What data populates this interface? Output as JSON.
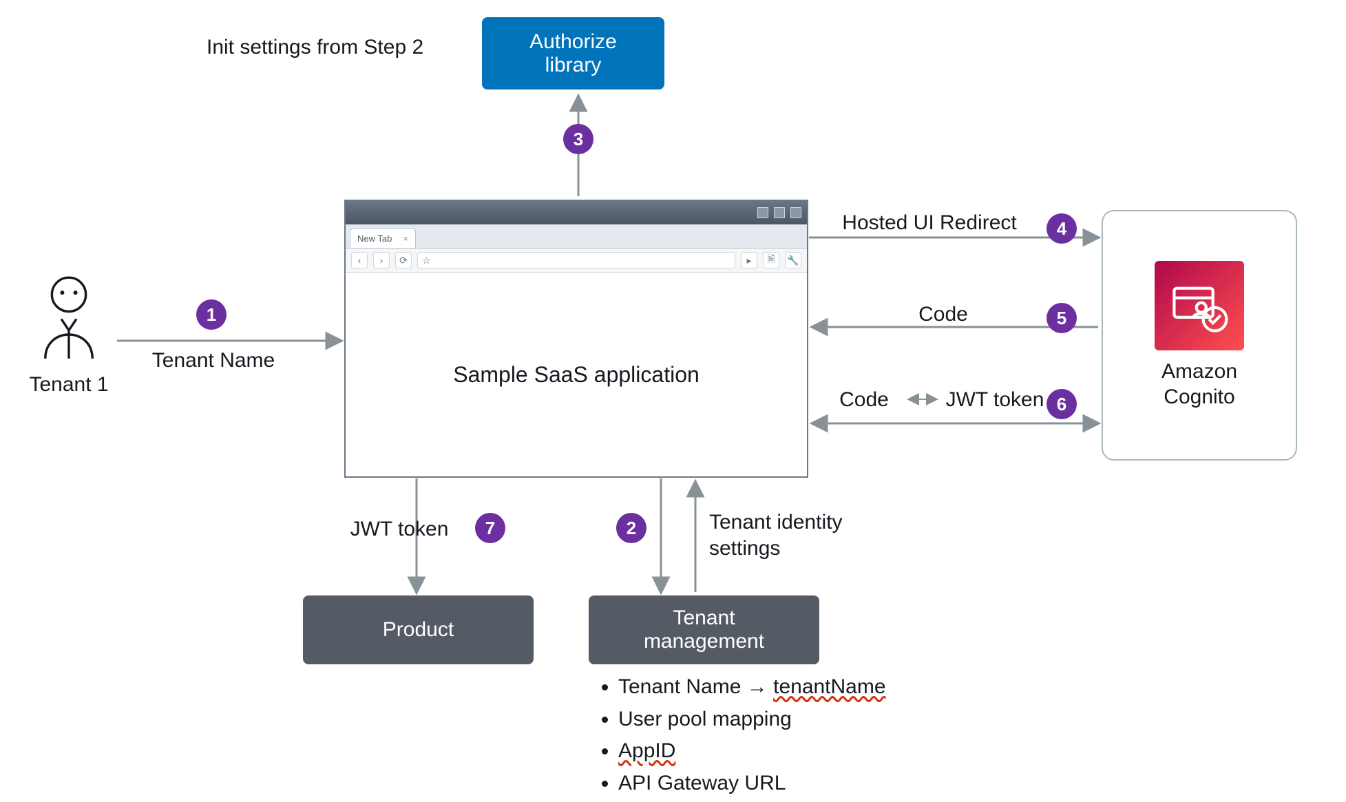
{
  "actors": {
    "tenant_label": "Tenant 1"
  },
  "browser": {
    "tab_label": "New Tab",
    "body_text": "Sample SaaS application"
  },
  "boxes": {
    "authorize": "Authorize\nlibrary",
    "product": "Product",
    "tenant_mgmt": "Tenant\nmanagement",
    "cognito": "Amazon\nCognito"
  },
  "steps": {
    "s1": "1",
    "s2": "2",
    "s3": "3",
    "s4": "4",
    "s5": "5",
    "s6": "6",
    "s7": "7"
  },
  "edge_labels": {
    "tenant_name": "Tenant Name",
    "init_settings": "Init settings from Step 2",
    "hosted_ui": "Hosted UI Redirect",
    "code": "Code",
    "code_jwt_left": "Code",
    "code_jwt_right": "JWT token",
    "jwt_token": "JWT token",
    "tenant_identity": "Tenant identity\nsettings"
  },
  "tenant_mgmt_details": {
    "b1_prefix": "Tenant Name → ",
    "b1_em": "tenantName",
    "b2": "User pool mapping",
    "b3": "AppID",
    "b4": "API Gateway URL"
  },
  "colors": {
    "badge": "#6b2fa0",
    "box_dark": "#545b64",
    "box_blue": "#0073bb",
    "cognito_grad_a": "#b0084d",
    "cognito_grad_b": "#ff4f4f",
    "arrow": "#879196"
  }
}
